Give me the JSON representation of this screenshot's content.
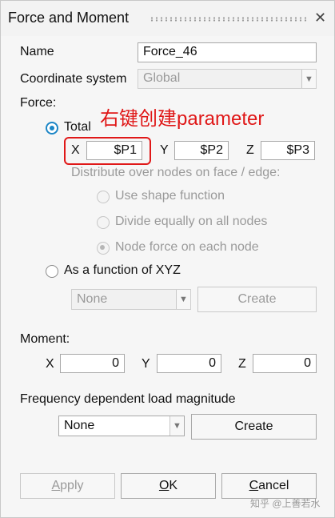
{
  "dialog": {
    "title": "Force and Moment",
    "name_label": "Name",
    "name_value": "Force_46",
    "coord_label": "Coordinate system",
    "coord_value": "Global"
  },
  "force": {
    "label": "Force:",
    "total_label": "Total",
    "x_label": "X",
    "x_value": "$P1",
    "y_label": "Y",
    "y_value": "$P2",
    "z_label": "Z",
    "z_value": "$P3",
    "distribute_label": "Distribute over nodes on face / edge:",
    "options": [
      "Use shape function",
      "Divide equally on all nodes",
      "Node force on each node"
    ],
    "selected_option_index": 2,
    "function_label": "As a function of XYZ",
    "function_combo_value": "None",
    "function_create_label": "Create"
  },
  "moment": {
    "label": "Moment:",
    "x_label": "X",
    "x_value": "0",
    "y_label": "Y",
    "y_value": "0",
    "z_label": "Z",
    "z_value": "0"
  },
  "frequency": {
    "label": "Frequency dependent load magnitude",
    "combo_value": "None",
    "create_label": "Create"
  },
  "buttons": {
    "apply_first": "A",
    "apply_rest": "pply",
    "ok_first": "O",
    "ok_rest": "K",
    "cancel_first": "C",
    "cancel_rest": "ancel"
  },
  "annotation": "右键创建parameter",
  "watermark": "知乎 @上善若水",
  "colors": {
    "accent": "#1c86c6",
    "annotation_red": "#e01818"
  }
}
